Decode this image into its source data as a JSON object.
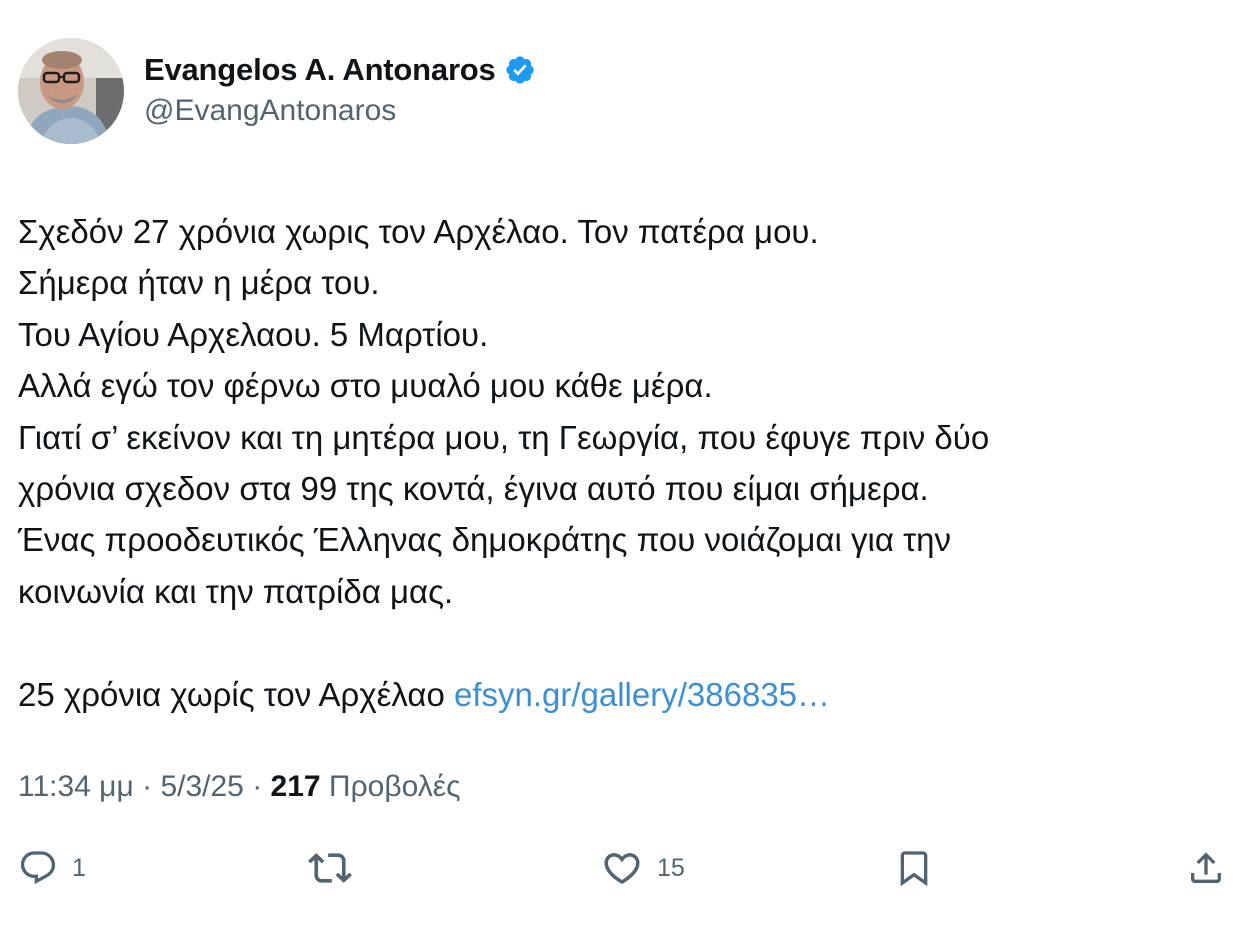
{
  "author": {
    "display_name": "Evangelos A. Antonaros",
    "handle": "@EvangAntonaros",
    "verified": true,
    "verified_color": "#1d9bf0"
  },
  "tweet": {
    "lines": [
      "Σχεδόν 27 χρόνια χωρις τον Αρχέλαο. Τον πατέρα μου.",
      "Σήμερα ήταν η μέρα του.",
      "Του Αγίου Αρχελαου. 5 Μαρτίου.",
      "Αλλά εγώ τον φέρνω στο μυαλό μου κάθε μέρα.",
      "Γιατί σ’ εκείνον και τη μητέρα μου, τη Γεωργία, που έφυγε πριν δύο",
      "χρόνια σχεδον στα 99 της κοντά, έγινα αυτό που είμαι σήμερα.",
      "Ένας προοδευτικός Έλληνας δημοκράτης που νοιάζομαι για την",
      "κοινωνία και την πατρίδα μας."
    ],
    "last_line_text": "25 χρόνια χωρίς τον Αρχέλαο ",
    "link_text": "efsyn.gr/gallery/386835…"
  },
  "meta": {
    "time": "11:34 μμ",
    "separator": " · ",
    "date": "5/3/25",
    "views_count": "217",
    "views_label": " Προβολές"
  },
  "actions": {
    "reply_count": "1",
    "like_count": "15"
  },
  "colors": {
    "text": "#0f1419",
    "secondary": "#536471",
    "link": "#3b8fd6"
  }
}
